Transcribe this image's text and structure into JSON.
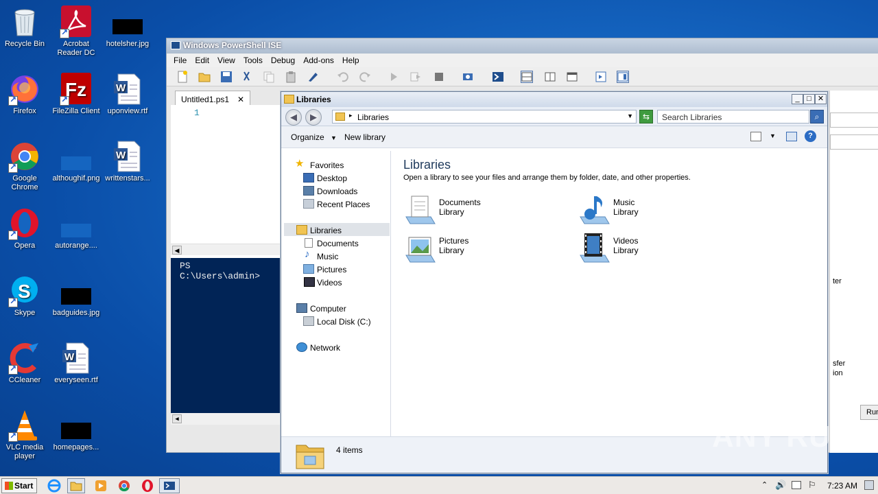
{
  "desktop": {
    "icons": [
      {
        "label": "Recycle Bin"
      },
      {
        "label": "Acrobat Reader DC"
      },
      {
        "label": "hotelsher.jpg"
      },
      {
        "label": "Firefox"
      },
      {
        "label": "FileZilla Client"
      },
      {
        "label": "uponview.rtf"
      },
      {
        "label": "Google Chrome"
      },
      {
        "label": "althoughif.png"
      },
      {
        "label": "writtenstars..."
      },
      {
        "label": "Opera"
      },
      {
        "label": "autorange...."
      },
      {
        "label": "Skype"
      },
      {
        "label": "badguides.jpg"
      },
      {
        "label": "CCleaner"
      },
      {
        "label": "everyseen.rtf"
      },
      {
        "label": "VLC media player"
      },
      {
        "label": "homepages..."
      }
    ]
  },
  "ise": {
    "title": "Windows PowerShell ISE",
    "menu": [
      "File",
      "Edit",
      "View",
      "Tools",
      "Debug",
      "Add-ons",
      "Help"
    ],
    "tab": "Untitled1.ps1",
    "tab_close": "✕",
    "line_number": "1",
    "prompt": "PS C:\\Users\\admin>",
    "partial_right": [
      "ter",
      "sfer",
      "ion",
      "Run"
    ]
  },
  "explorer": {
    "title": "Libraries",
    "breadcrumb": "Libraries",
    "search_placeholder": "Search Libraries",
    "toolbar": {
      "organize": "Organize",
      "new_library": "New library"
    },
    "nav": {
      "favorites": "Favorites",
      "desktop": "Desktop",
      "downloads": "Downloads",
      "recent": "Recent Places",
      "libraries": "Libraries",
      "documents": "Documents",
      "music": "Music",
      "pictures": "Pictures",
      "videos": "Videos",
      "computer": "Computer",
      "local_disk": "Local Disk (C:)",
      "network": "Network"
    },
    "content": {
      "heading": "Libraries",
      "description": "Open a library to see your files and arrange them by folder, date, and other properties.",
      "items": [
        {
          "name": "Documents",
          "sub": "Library"
        },
        {
          "name": "Music",
          "sub": "Library"
        },
        {
          "name": "Pictures",
          "sub": "Library"
        },
        {
          "name": "Videos",
          "sub": "Library"
        }
      ]
    },
    "status": "4 items"
  },
  "taskbar": {
    "start": "Start",
    "clock": "7:23 AM"
  },
  "watermark": "ANY RUN"
}
